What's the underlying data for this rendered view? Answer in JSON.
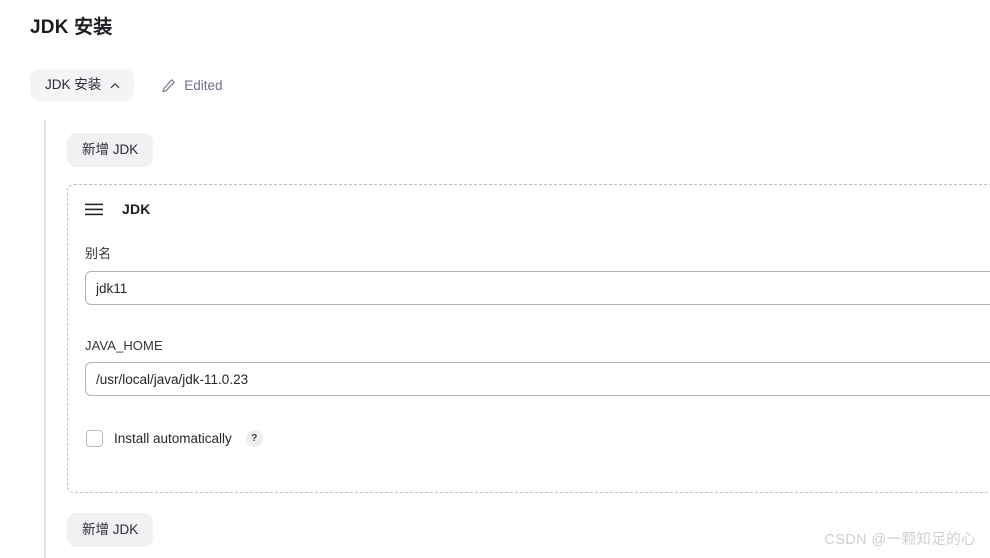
{
  "page": {
    "title": "JDK 安装"
  },
  "section": {
    "collapse_label": "JDK 安装",
    "collapse_icon": "chevron-up-icon",
    "edited_label": "Edited",
    "edited_icon": "pencil-icon"
  },
  "actions": {
    "add_top_label": "新增 JDK",
    "add_bottom_label": "新增 JDK"
  },
  "entry": {
    "drag_icon": "hamburger-drag-handle-icon",
    "title": "JDK",
    "fields": [
      {
        "label": "别名",
        "value": "jdk11",
        "placeholder": ""
      },
      {
        "label": "JAVA_HOME",
        "value": "/usr/local/java/jdk-11.0.23",
        "placeholder": ""
      }
    ],
    "checkbox": {
      "label": "Install automatically",
      "checked": false,
      "help_icon": "question-mark-icon",
      "help_glyph": "?"
    }
  },
  "watermark": {
    "text": "CSDN @一颗知足的心"
  },
  "colors": {
    "page_bg": "#ffffff",
    "title_text": "#1a1c20",
    "button_bg": "#f1f1f4",
    "edited_text": "#6e6f8a",
    "dashed_border": "#b9c2cc",
    "input_border": "#aab6bd",
    "left_rule": "#dcdfe4",
    "watermark": "#cfcfd3"
  }
}
